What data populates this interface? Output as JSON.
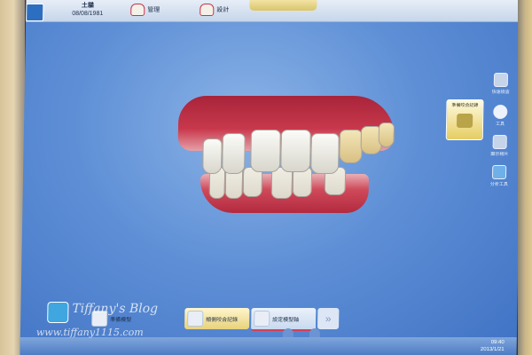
{
  "header": {
    "patient_name": "土貓",
    "patient_date": "08/08/1981",
    "tab_manage": "管理",
    "tab_design": "設計"
  },
  "tools": [
    {
      "label": "準備咬合記錄",
      "icon": "bite-record-icon"
    },
    {
      "label": "快速檢查",
      "icon": "quick-check-icon"
    },
    {
      "label": "工具",
      "icon": "tools-icon"
    },
    {
      "label": "顯示相片",
      "icon": "photo-icon"
    },
    {
      "label": "分析工具",
      "icon": "analysis-icon"
    }
  ],
  "workflow": {
    "step_prep": "準備模型",
    "step_bite": "頰側咬合記錄",
    "step_next": "設定模型軸"
  },
  "watermark": {
    "title": "Tiffany's Blog",
    "url": "www.tiffany1115.com"
  },
  "taskbar": {
    "time": "09:40",
    "date": "2013/1/21"
  },
  "colors": {
    "screen_bg": "#5e8fd6",
    "active_tab": "#e8d27a",
    "gum": "#c8384c"
  }
}
